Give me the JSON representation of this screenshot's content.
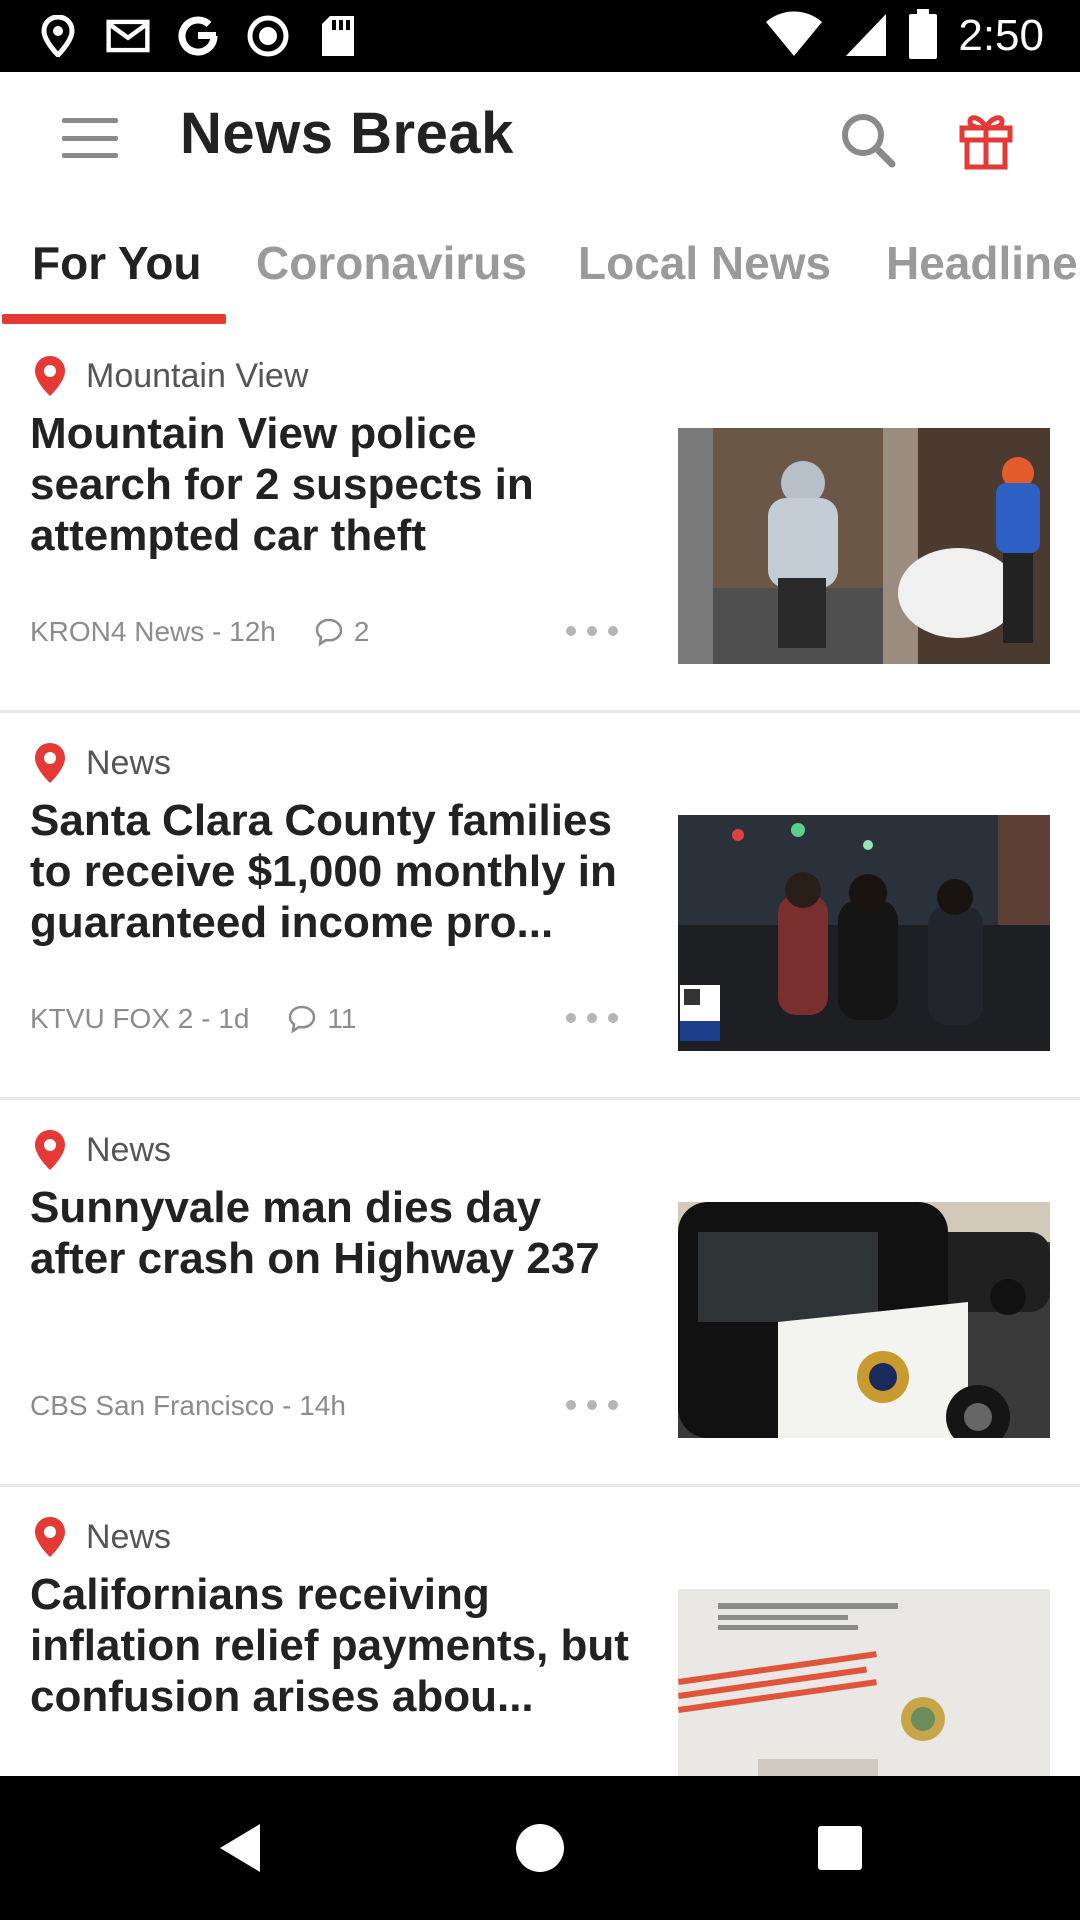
{
  "status_bar": {
    "time": "2:50",
    "icons": [
      "location-icon",
      "gmail-icon",
      "google-icon",
      "record-icon",
      "sd-card-icon",
      "wifi-icon",
      "signal-icon",
      "battery-icon"
    ]
  },
  "app_bar": {
    "title": "News Break",
    "icons": [
      "menu-icon",
      "search-icon",
      "gift-icon"
    ],
    "accent_color": "#e53935"
  },
  "tabs": [
    {
      "label": "For You",
      "active": true
    },
    {
      "label": "Coronavirus",
      "active": false
    },
    {
      "label": "Local News",
      "active": false
    },
    {
      "label": "Headlines",
      "active": false
    }
  ],
  "feed": [
    {
      "tag": "Mountain View",
      "headline": "Mountain View police search for 2 suspects in attempted car theft",
      "source": "KRON4 News - 12h",
      "comments": "2",
      "image": "suspects-photo"
    },
    {
      "tag": "News",
      "headline": "Santa Clara County families to receive $1,000 monthly in guaranteed income pro...",
      "source": "KTVU FOX 2 - 1d",
      "comments": "11",
      "image": "street-crowd-photo"
    },
    {
      "tag": "News",
      "headline": "Sunnyvale man dies day after crash on Highway 237",
      "source": "CBS San Francisco - 14h",
      "comments": "",
      "image": "highway-patrol-car-photo"
    },
    {
      "tag": "News",
      "headline": "Californians receiving inflation relief payments, but confusion arises abou...",
      "source": "",
      "comments": "",
      "image": "tax-refund-letter-photo"
    }
  ],
  "nav_bar": {
    "icons": [
      "back-icon",
      "home-icon",
      "recents-icon"
    ]
  }
}
